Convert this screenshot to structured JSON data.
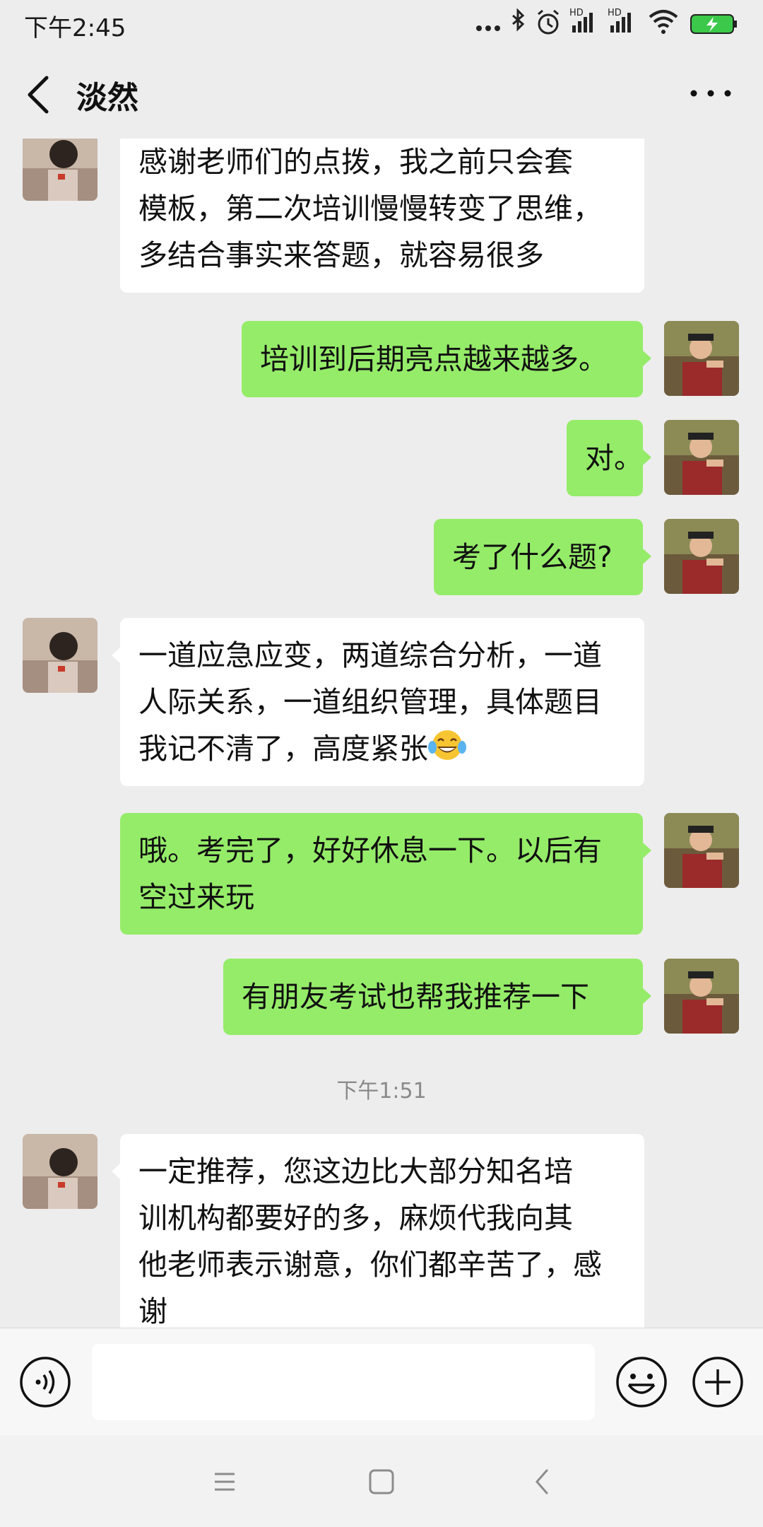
{
  "status_bar": {
    "time": "下午2:45",
    "icons": [
      "more-dots-icon",
      "bluetooth-icon",
      "alarm-icon",
      "hd-signal-icon",
      "hd-signal-icon",
      "wifi-icon",
      "battery-charging-icon"
    ],
    "hd_label": "HD"
  },
  "header": {
    "title": "淡然",
    "back_icon": "back-chevron-icon",
    "more_icon": "more-options-icon"
  },
  "messages": [
    {
      "side": "in",
      "lines": [
        "感谢老师们的点拨，我之前只会套",
        "模板，第二次培训慢慢转变了思维，",
        "多结合事实来答题，就容易很多"
      ]
    },
    {
      "side": "out",
      "lines": [
        "培训到后期亮点越来越多。"
      ]
    },
    {
      "side": "out",
      "lines": [
        "对。"
      ]
    },
    {
      "side": "out",
      "lines": [
        "考了什么题?"
      ]
    },
    {
      "side": "in",
      "lines": [
        "一道应急应变，两道综合分析，一道",
        "人际关系，一道组织管理，具体题目",
        "我记不清了，高度紧张"
      ],
      "emoji": "tears-of-joy-emoji"
    },
    {
      "side": "out",
      "lines": [
        "哦。考完了，好好休息一下。以后有",
        "空过来玩"
      ]
    },
    {
      "side": "out",
      "lines": [
        "有朋友考试也帮我推荐一下"
      ]
    },
    {
      "side": "in",
      "lines": [
        "一定推荐，您这边比大部分知名培",
        "训机构都要好的多，麻烦代我向其",
        "他老师表示谢意，你们都辛苦了，感",
        "谢"
      ]
    }
  ],
  "timestamp": "下午1:51",
  "input_bar": {
    "placeholder": "",
    "icons": [
      "voice-icon",
      "emoji-icon",
      "plus-icon"
    ]
  },
  "nav_bar": {
    "icons": [
      "menu-icon",
      "home-icon",
      "back-icon"
    ]
  },
  "colors": {
    "background": "#ededed",
    "outgoing_bubble": "#95ec69",
    "incoming_bubble": "#ffffff",
    "timestamp_text": "#8a8a8a"
  }
}
